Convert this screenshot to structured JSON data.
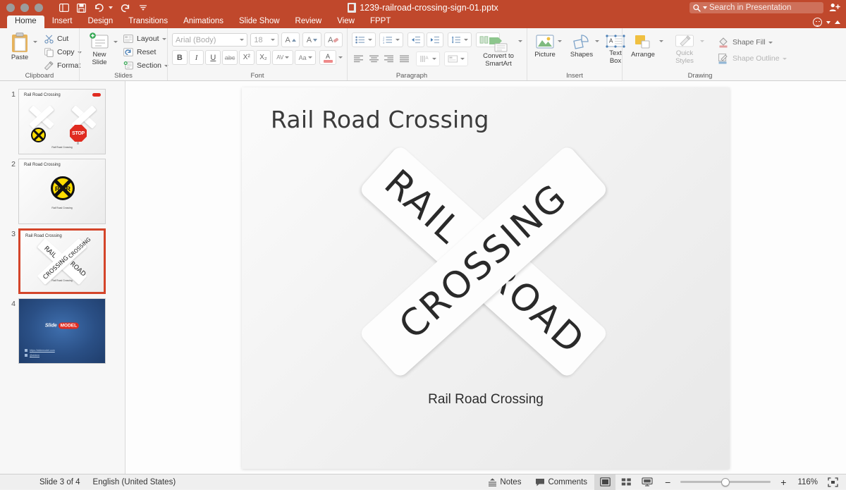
{
  "titlebar": {
    "document_title": "1239-railroad-crossing-sign-01.pptx",
    "quick_access": [
      {
        "name": "sidebar-toggle-icon",
        "label": "Sidebar"
      },
      {
        "name": "save-icon",
        "label": "Save"
      },
      {
        "name": "undo-icon",
        "label": "Undo"
      },
      {
        "name": "redo-icon",
        "label": "Redo"
      },
      {
        "name": "customize-qat-icon",
        "label": "Customize"
      }
    ],
    "search_placeholder": "Search in Presentation",
    "share_label": "Share",
    "accent_color": "#c0482c"
  },
  "tabs": [
    {
      "label": "Home",
      "active": true
    },
    {
      "label": "Insert",
      "active": false
    },
    {
      "label": "Design",
      "active": false
    },
    {
      "label": "Transitions",
      "active": false
    },
    {
      "label": "Animations",
      "active": false
    },
    {
      "label": "Slide Show",
      "active": false
    },
    {
      "label": "Review",
      "active": false
    },
    {
      "label": "View",
      "active": false
    },
    {
      "label": "FPPT",
      "active": false
    }
  ],
  "ribbon": {
    "groups": [
      {
        "label": "Clipboard",
        "paste_label": "Paste",
        "cut_label": "Cut",
        "copy_label": "Copy",
        "format_label": "Format"
      },
      {
        "label": "Slides",
        "new_slide_label": "New\nSlide",
        "new_slide_line1": "New",
        "new_slide_line2": "Slide",
        "layout_label": "Layout",
        "reset_label": "Reset",
        "section_label": "Section"
      },
      {
        "label": "Font",
        "font_name": "Arial (Body)",
        "font_size": "18",
        "grow_font": "A",
        "shrink_font": "A",
        "clear_formatting": "A",
        "bold": "B",
        "italic": "I",
        "underline": "U",
        "strikethrough": "abc",
        "superscript": "X²",
        "subscript": "X₂",
        "character_spacing": "AV",
        "change_case": "Aa",
        "font_color": "A"
      },
      {
        "label": "Paragraph",
        "bullets": "Bullets",
        "numbering": "Numbering",
        "decrease_indent": "Decrease Indent",
        "increase_indent": "Increase Indent",
        "line_spacing": "Line Spacing",
        "columns": "Columns",
        "align_left": "Align Left",
        "align_center": "Center",
        "align_right": "Align Right",
        "justify": "Justify",
        "text_direction": "Text Direction",
        "align_text": "Align Text",
        "convert_to_smartart_line1": "Convert to",
        "convert_to_smartart_line2": "SmartArt"
      },
      {
        "label": "Insert",
        "picture_label": "Picture",
        "shapes_label": "Shapes",
        "textbox_line1": "Text",
        "textbox_line2": "Box"
      },
      {
        "label": "Drawing",
        "arrange_label": "Arrange",
        "quick_styles_line1": "Quick",
        "quick_styles_line2": "Styles",
        "shape_fill_label": "Shape Fill",
        "shape_outline_label": "Shape Outline"
      }
    ]
  },
  "thumbnails": [
    {
      "number": "1",
      "title": "Rail Road Crossing",
      "caption": "Rail Road Crossing",
      "selected": false,
      "kind": "two-signs"
    },
    {
      "number": "2",
      "title": "Rail Road Crossing",
      "caption": "Rail Road Crossing",
      "selected": false,
      "kind": "disc-sign"
    },
    {
      "number": "3",
      "title": "Rail Road Crossing",
      "caption": "Rail Road Crossing",
      "selected": true,
      "kind": "crossbuck"
    },
    {
      "number": "4",
      "title": "",
      "caption": "",
      "selected": false,
      "kind": "blue-end"
    }
  ],
  "slide": {
    "title": "Rail Road Crossing",
    "caption": "Rail Road Crossing",
    "crossbuck": {
      "plank_a_text": "RAIL",
      "plank_b_text": "CROSSING",
      "plank_c_text": "ROAD"
    }
  },
  "statusbar": {
    "slide_counter": "Slide 3 of 4",
    "language": "English (United States)",
    "notes_label": "Notes",
    "comments_label": "Comments",
    "view_normal": "Normal View",
    "view_slide_sorter": "Slide Sorter",
    "view_slideshow": "Slide Show",
    "zoom_out": "−",
    "zoom_in": "+",
    "zoom_level": "116%",
    "fit_to_window": "Fit to Window"
  }
}
